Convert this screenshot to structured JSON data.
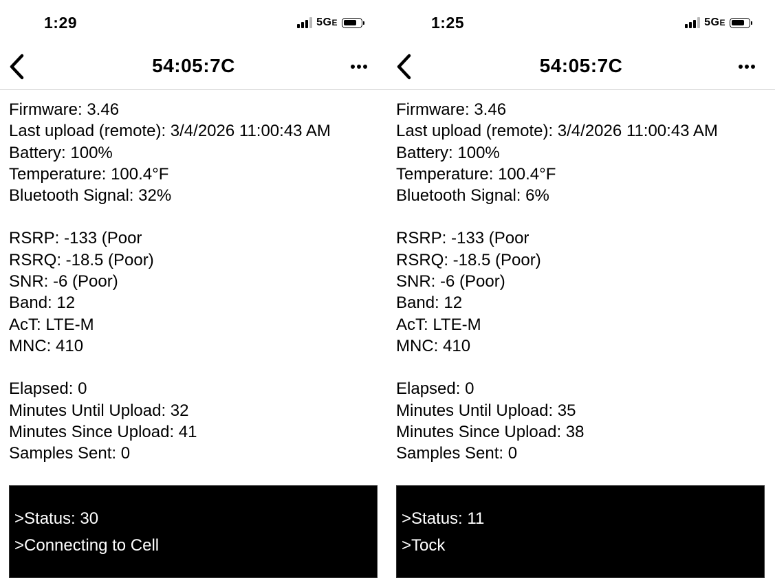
{
  "screens": [
    {
      "status_bar": {
        "time": "1:29",
        "network": "5G",
        "network_suffix": "E"
      },
      "nav": {
        "title": "54:05:7C",
        "back_icon": "chevron-left-icon",
        "more_icon": "ellipsis-icon",
        "more_label": "•••"
      },
      "group1": {
        "firmware": "Firmware: 3.46",
        "last_upload": "Last upload (remote): 3/4/2026 11:00:43 AM",
        "battery": "Battery: 100%",
        "temperature": "Temperature: 100.4°F",
        "bluetooth": "Bluetooth Signal: 32%"
      },
      "group2": {
        "rsrp": "RSRP: -133 (Poor",
        "rsrq": "RSRQ: -18.5 (Poor)",
        "snr": "SNR: -6 (Poor)",
        "band": "Band: 12",
        "act": "AcT: LTE-M",
        "mnc": "MNC: 410"
      },
      "group3": {
        "elapsed": "Elapsed: 0",
        "minutes_until": "Minutes Until Upload: 32",
        "minutes_since": "Minutes Since Upload: 41",
        "samples": "Samples Sent: 0"
      },
      "console": {
        "line1": ">Status: 30",
        "line2": ">Connecting to Cell"
      }
    },
    {
      "status_bar": {
        "time": "1:25",
        "network": "5G",
        "network_suffix": "E"
      },
      "nav": {
        "title": "54:05:7C",
        "back_icon": "chevron-left-icon",
        "more_icon": "ellipsis-icon",
        "more_label": "•••"
      },
      "group1": {
        "firmware": "Firmware: 3.46",
        "last_upload": "Last upload (remote): 3/4/2026 11:00:43 AM",
        "battery": "Battery: 100%",
        "temperature": "Temperature: 100.4°F",
        "bluetooth": "Bluetooth Signal: 6%"
      },
      "group2": {
        "rsrp": "RSRP: -133 (Poor",
        "rsrq": "RSRQ: -18.5 (Poor)",
        "snr": "SNR: -6 (Poor)",
        "band": "Band: 12",
        "act": "AcT: LTE-M",
        "mnc": "MNC: 410"
      },
      "group3": {
        "elapsed": "Elapsed: 0",
        "minutes_until": "Minutes Until Upload: 35",
        "minutes_since": "Minutes Since Upload: 38",
        "samples": "Samples Sent: 0"
      },
      "console": {
        "line1": ">Status: 11",
        "line2": ">Tock"
      }
    }
  ]
}
